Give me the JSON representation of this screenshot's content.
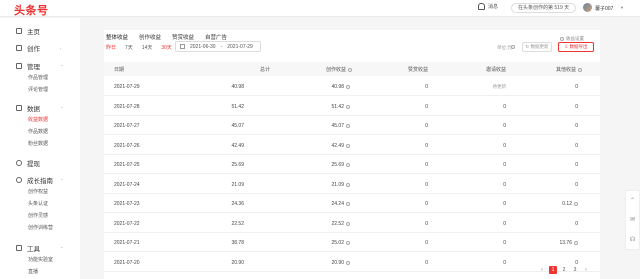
{
  "header": {
    "logo": "头条号",
    "messages_label": "消息",
    "days_pill": "在头条创作的第 519 天",
    "username": "薯子007"
  },
  "sidebar": {
    "items": [
      {
        "label": "主页",
        "icon": "home-icon"
      },
      {
        "label": "创作",
        "icon": "edit-icon"
      },
      {
        "label": "管理",
        "icon": "manage-icon"
      },
      {
        "label": "数据",
        "icon": "data-icon"
      },
      {
        "label": "提现",
        "icon": "withdraw-icon"
      },
      {
        "label": "成长指南",
        "icon": "growth-icon"
      },
      {
        "label": "工具",
        "icon": "tools-icon"
      }
    ],
    "manage_subs": [
      "作品管理",
      "评论管理"
    ],
    "data_subs": [
      "收益数据",
      "作品数据",
      "粉丝数据"
    ],
    "growth_subs": [
      "创作权益",
      "头条认证",
      "创作灵感",
      "创作训练营"
    ],
    "tools_subs": [
      "功能实验室",
      "直播"
    ]
  },
  "main": {
    "tabs": [
      "整体收益",
      "创作收益",
      "赞赏收益",
      "自营广告"
    ],
    "ranges": [
      "昨日",
      "7天",
      "14天",
      "30天"
    ],
    "date_from": "2021-06-30",
    "date_to": "2021-07-29",
    "settings_label": "收益设置",
    "unit_label": "单位:元",
    "refresh_label": "数据更新",
    "export_label": "数据导出",
    "columns": [
      "日期",
      "总计",
      "创作收益",
      "赞赏收益",
      "邀请收益",
      "其他收益"
    ],
    "rows": [
      {
        "date": "2021-07-29",
        "total": "40.98",
        "creation": "40.98",
        "reward": "0",
        "invite": "待更新",
        "other": "0"
      },
      {
        "date": "2021-07-28",
        "total": "51.42",
        "creation": "51.42",
        "reward": "0",
        "invite": "0",
        "other": "0"
      },
      {
        "date": "2021-07-27",
        "total": "45.07",
        "creation": "45.07",
        "reward": "0",
        "invite": "0",
        "other": "0"
      },
      {
        "date": "2021-07-26",
        "total": "42.49",
        "creation": "42.49",
        "reward": "0",
        "invite": "0",
        "other": "0"
      },
      {
        "date": "2021-07-25",
        "total": "25.69",
        "creation": "25.69",
        "reward": "0",
        "invite": "0",
        "other": "0"
      },
      {
        "date": "2021-07-24",
        "total": "21.09",
        "creation": "21.09",
        "reward": "0",
        "invite": "0",
        "other": "0"
      },
      {
        "date": "2021-07-23",
        "total": "24.36",
        "creation": "24.24",
        "reward": "0",
        "invite": "0",
        "other": "0.12"
      },
      {
        "date": "2021-07-22",
        "total": "22.52",
        "creation": "22.52",
        "reward": "0",
        "invite": "0",
        "other": "0"
      },
      {
        "date": "2021-07-21",
        "total": "38.78",
        "creation": "25.02",
        "reward": "0",
        "invite": "0",
        "other": "13.76"
      },
      {
        "date": "2021-07-20",
        "total": "20.90",
        "creation": "20.90",
        "reward": "0",
        "invite": "0",
        "other": "0"
      }
    ],
    "pages": [
      "1",
      "2",
      "3"
    ]
  },
  "colors": {
    "accent": "#e33333"
  }
}
